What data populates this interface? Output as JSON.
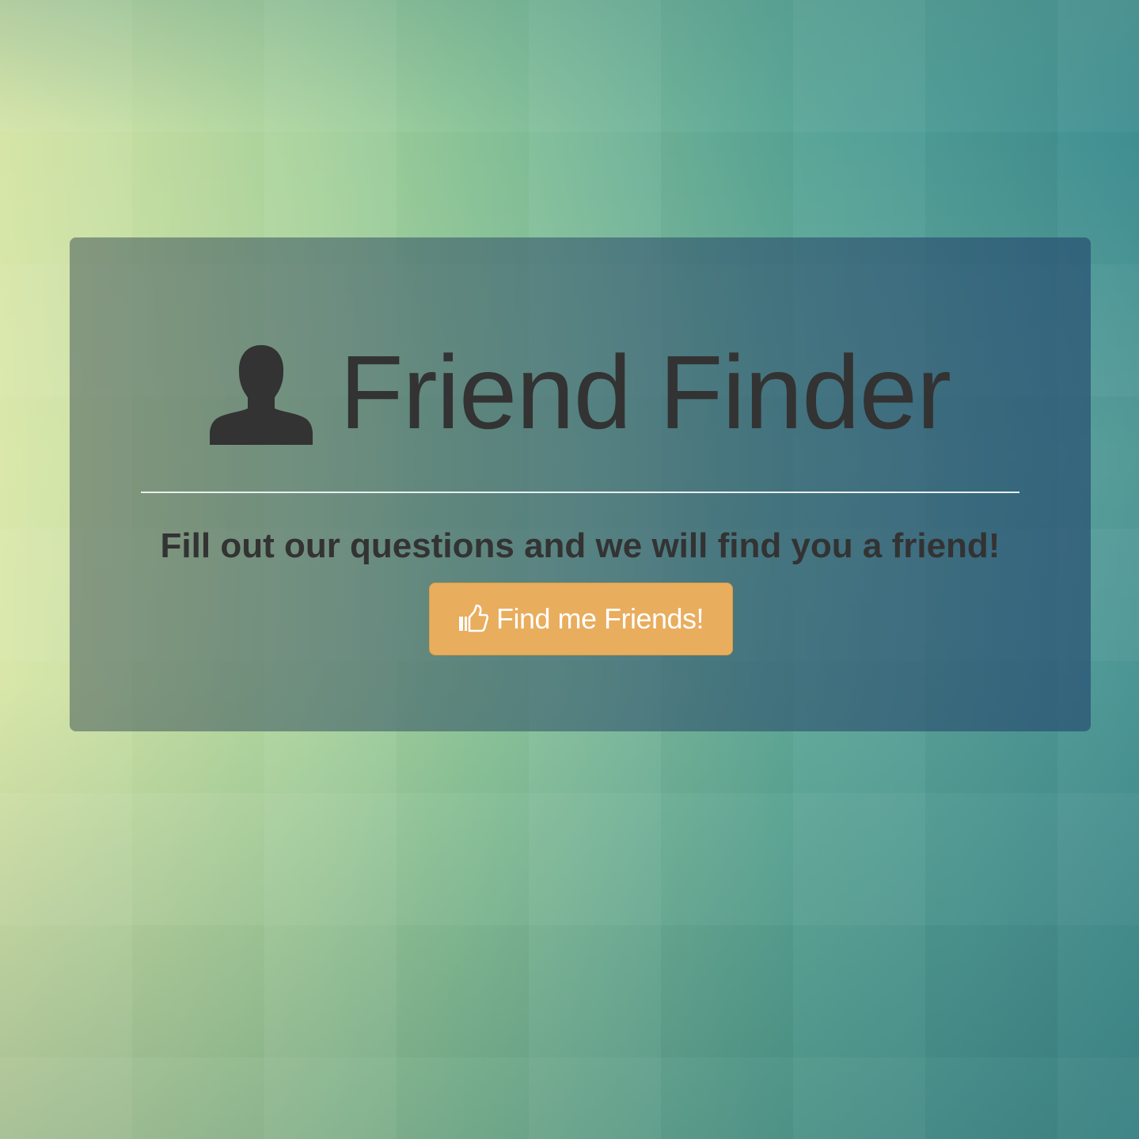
{
  "page": {
    "title": "Friend Finder",
    "title_icon": "user-icon",
    "tagline": "Fill out our questions and we will find you a friend!"
  },
  "cta": {
    "label": "Find me Friends!",
    "icon": "thumbs-up-icon"
  },
  "colors": {
    "title_text": "#333333",
    "button_bg": "#e9ad5e",
    "button_text": "#ffffff",
    "panel_overlay": "#3f6070"
  }
}
